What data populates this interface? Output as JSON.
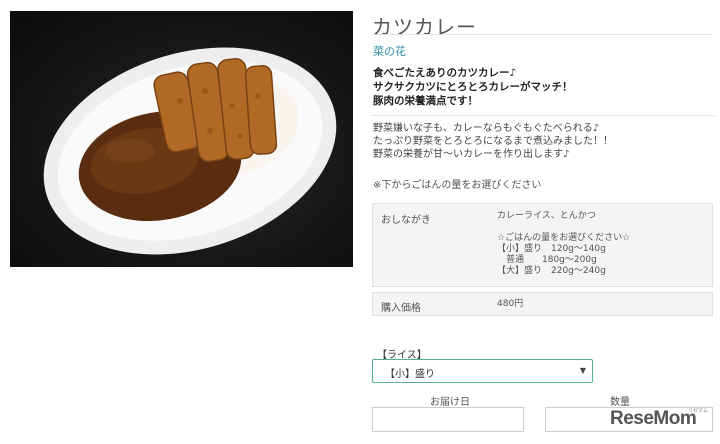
{
  "product": {
    "name": "カツカレー",
    "shop": "菜の花",
    "catch_lines": [
      "食べごたえありのカツカレー♪",
      "サクサクカツにとろとろカレーがマッチ！",
      "豚肉の栄養満点です！"
    ],
    "desc_lines": [
      "野菜嫌いな子も、カレーならもぐもぐたべられる♪",
      "たっぷり野菜をとろとろになるまで煮込みました！！",
      "野菜の栄養が甘～いカレーを作り出します♪"
    ],
    "note": "※下からごはんの量をお選びください"
  },
  "details": {
    "menu_label": "おしながき",
    "menu_lines": [
      "カレーライス、とんかつ",
      "",
      "☆ごはんの量をお選びください☆",
      "【小】盛り　120g～140g",
      "　普通　　180g～200g",
      "【大】盛り　220g～240g"
    ],
    "price_label": "購入価格",
    "price_value": "480円"
  },
  "form": {
    "rice_label": "【ライス】",
    "rice_selected": "【小】盛り",
    "date_label": "お届け日",
    "qty_label": "数量"
  },
  "watermark": {
    "logo": "ReseMom",
    "sub": "リセマム"
  },
  "colors": {
    "link": "#2a8fa8",
    "select_border": "#55b08e",
    "curry": "#5a2d10",
    "katsu": "#b06a26"
  },
  "icons": {
    "select_arrow": "chevron-down-icon"
  }
}
